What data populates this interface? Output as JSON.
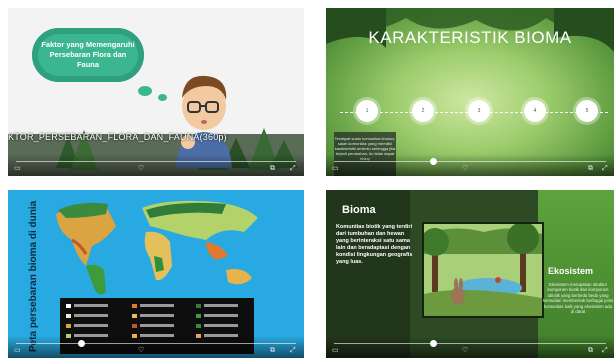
{
  "tiles": {
    "t1": {
      "cloud_text": "Faktor yang Memengaruhi Persebaran Flora dan Fauna",
      "caption": "KTOR_PERSEBARAN_FLORA_DAN_FAUNA(360p)"
    },
    "t2": {
      "title": "KARAKTERISTIK BIOMA",
      "nodes": [
        "1",
        "2",
        "3",
        "4",
        "5"
      ],
      "note": "Terdapat suatu komunitas khusus, salah komunitas yang memiliki karakteristik tertentu sehingga jika terjadi perubahan, itu tidak dapat hidup"
    },
    "t3": {
      "title": "Peta persebaran bioma di dunia",
      "legend": [
        "ES",
        "HUTAN MUSIM",
        "SABANA PEGUNUNGAN",
        "TUNDRA ARKTIK",
        "TUNDRA",
        "HUTAN HUJAN SUBTROPIS",
        "TAIGA",
        "HUTAN GUGUR",
        "HUTAN HUJAN TROPIS",
        "GURUN",
        "PADANG RUMPUT",
        "GURUN PEGUNUNGAN"
      ]
    },
    "t4": {
      "bioma_title": "Bioma",
      "bioma_text": "Komunitas biotik yang terdiri dari tumbuhan dan hewan yang berinteraksi satu sama lain dan beradaptasi dengan kondisi lingkungan geografis yang luas.",
      "eko_title": "Ekosistem",
      "eko_text": "Ekosistem merupakan struktur komponen biotik dan komponen abiotik yang berbeda beda yang kemudian membentuk berbagai jenis komunitas baik yang ekosistem ada di darat"
    }
  },
  "colors": {
    "cloud": "#3cb68f",
    "map_bg": "#29a9e1",
    "tile2_center": "#cfe7a2"
  },
  "player_icons": [
    "subtitles-icon",
    "like-icon",
    "share-icon",
    "pip-icon",
    "fullscreen-icon"
  ]
}
